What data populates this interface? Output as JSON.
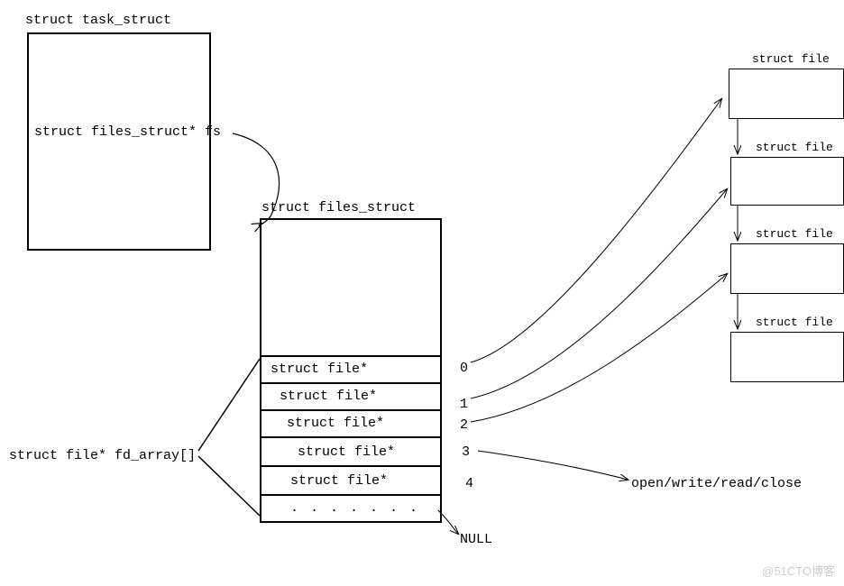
{
  "task_struct": {
    "title": "struct task_struct",
    "field": "struct files_struct* fs"
  },
  "files_struct": {
    "title": "struct files_struct",
    "array_label": "struct file* fd_array[]",
    "rows": [
      {
        "text": "struct file*",
        "index": "0"
      },
      {
        "text": "struct file*",
        "index": "1"
      },
      {
        "text": "struct file*",
        "index": "2"
      },
      {
        "text": "struct file*",
        "index": "3"
      },
      {
        "text": "struct file*",
        "index": "4"
      }
    ],
    "ellipsis": ". . . . . . .",
    "null_label": "NULL"
  },
  "files": {
    "items": [
      {
        "label": "struct file"
      },
      {
        "label": "struct file"
      },
      {
        "label": "struct file"
      },
      {
        "label": "struct file"
      }
    ]
  },
  "ops_label": "open/write/read/close",
  "watermark": "@51CTO博客"
}
